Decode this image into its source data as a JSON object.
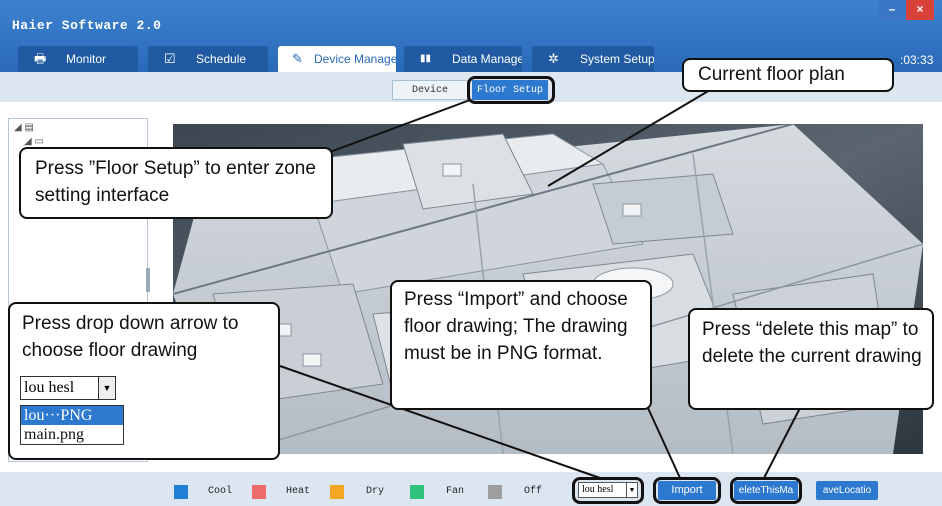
{
  "window": {
    "title": "Haier Software 2.0",
    "minimize": "–",
    "close": "×"
  },
  "tabs": [
    {
      "label": "Monitor",
      "icon": "printer-icon",
      "glyph": "🖶"
    },
    {
      "label": "Schedule",
      "icon": "calendar-icon",
      "glyph": "☑"
    },
    {
      "label": "Device Manager",
      "icon": "wrench-icon",
      "glyph": "✎"
    },
    {
      "label": "Data Manage",
      "icon": "bar-chart-icon",
      "glyph": "▮▮"
    },
    {
      "label": "System Setup",
      "icon": "gear-icon",
      "glyph": "✲"
    }
  ],
  "clock": ":03:33",
  "subtabs": {
    "device": "Device Manage",
    "floor": "Floor Setup"
  },
  "tree": {
    "root_glyph": "◢ ▤",
    "child_glyph": "◢ ▭"
  },
  "legend": [
    {
      "label": "Cool",
      "color": "#1f7fd6"
    },
    {
      "label": "Heat",
      "color": "#ee6b6b"
    },
    {
      "label": "Dry",
      "color": "#f5a623"
    },
    {
      "label": "Fan",
      "color": "#2ec27e"
    },
    {
      "label": "Off",
      "color": "#9e9e9e"
    }
  ],
  "floor_select": {
    "value": "lou hesl",
    "arrow": "▼"
  },
  "buttons": {
    "import": "Import",
    "delete": "eleteThisMa",
    "save": "aveLocatio"
  },
  "callouts": {
    "current_floor": "Current floor plan",
    "floor_setup": "Press ”Floor Setup” to enter zone setting interface",
    "dropdown": "Press drop down arrow to choose floor drawing",
    "import": "Press “Import” and choose floor drawing; The drawing must be in PNG format.",
    "delete": "Press “delete this map” to delete the current drawing"
  },
  "popup": {
    "selected": "lou hesl",
    "arrow": "▼",
    "options": [
      "lou···PNG",
      "main.png"
    ]
  },
  "colors": {
    "titlebar": "#2a69b9",
    "accent": "#2d79d0"
  }
}
